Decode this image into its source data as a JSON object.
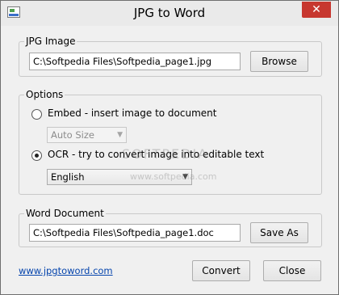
{
  "window": {
    "title": "JPG to Word",
    "close_glyph": "✕"
  },
  "jpg_group": {
    "legend": "JPG Image",
    "path": "C:\\Softpedia Files\\Softpedia_page1.jpg",
    "browse": "Browse"
  },
  "options": {
    "legend": "Options",
    "embed_label": "Embed - insert image to document",
    "embed_select": "Auto Size",
    "ocr_label": "OCR - try to convert image into editable text",
    "ocr_select": "English",
    "selected": "ocr"
  },
  "word_group": {
    "legend": "Word Document",
    "path": "C:\\Softpedia Files\\Softpedia_page1.doc",
    "save_as": "Save As"
  },
  "footer": {
    "link": "www.jpgtoword.com",
    "convert": "Convert",
    "close": "Close"
  },
  "watermark": {
    "big": "SOFTPEDIA",
    "small": "www.softpedia.com"
  },
  "icons": {
    "app": "jpg-to-word-app-icon",
    "chevron": "▼"
  }
}
